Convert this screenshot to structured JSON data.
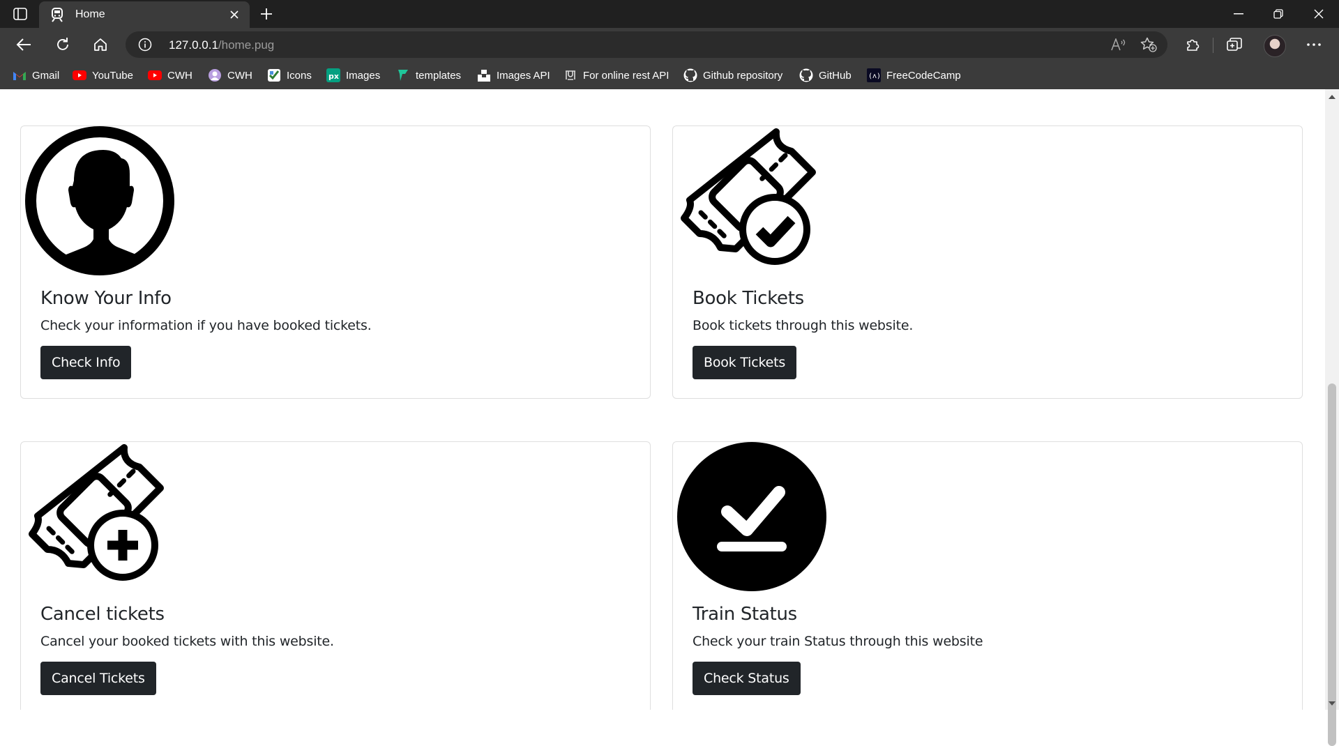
{
  "browser": {
    "tab_title": "Home",
    "url_host": "127.0.0.1",
    "url_path": "/home.pug",
    "bookmarks": [
      {
        "label": "Gmail",
        "icon": "gmail-icon"
      },
      {
        "label": "YouTube",
        "icon": "youtube-icon"
      },
      {
        "label": "CWH",
        "icon": "youtube-icon"
      },
      {
        "label": "CWH",
        "icon": "cwh-icon"
      },
      {
        "label": "Icons",
        "icon": "icons-site-icon"
      },
      {
        "label": "Images",
        "icon": "pexels-icon"
      },
      {
        "label": "templates",
        "icon": "templates-icon"
      },
      {
        "label": "Images API",
        "icon": "unsplash-icon"
      },
      {
        "label": "For online rest API",
        "icon": "rest-api-icon"
      },
      {
        "label": "Github repository",
        "icon": "github-icon"
      },
      {
        "label": "GitHub",
        "icon": "github-icon"
      },
      {
        "label": "FreeCodeCamp",
        "icon": "freecodecamp-icon"
      }
    ]
  },
  "cards": [
    {
      "title": "Know Your Info",
      "text": "Check your information if you have booked tickets.",
      "button": "Check Info",
      "icon": "user-profile-icon"
    },
    {
      "title": "Book Tickets",
      "text": "Book tickets through this website.",
      "button": "Book Tickets",
      "icon": "ticket-check-icon"
    },
    {
      "title": "Cancel tickets",
      "text": "Cancel your booked tickets with this website.",
      "button": "Cancel Tickets",
      "icon": "ticket-add-icon"
    },
    {
      "title": "Train Status",
      "text": "Check your train Status through this website",
      "button": "Check Status",
      "icon": "status-check-icon"
    }
  ],
  "colors": {
    "tabstrip_bg": "#202020",
    "toolbar_bg": "#3b3b3b",
    "button_bg": "#212529",
    "text": "#212529"
  }
}
